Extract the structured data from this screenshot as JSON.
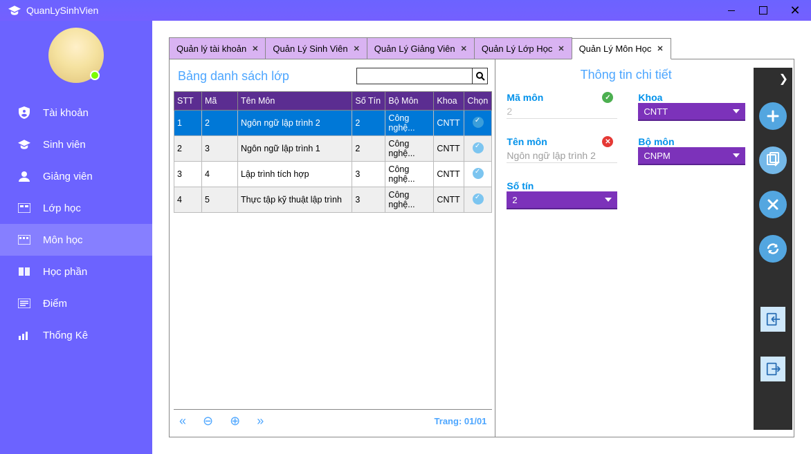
{
  "app": {
    "title": "QuanLySinhVien"
  },
  "sidebar": {
    "items": [
      {
        "label": "Tài khoản",
        "icon": "shield-user-icon"
      },
      {
        "label": "Sinh viên",
        "icon": "grad-cap-small-icon"
      },
      {
        "label": "Giảng viên",
        "icon": "user-icon"
      },
      {
        "label": "Lớp học",
        "icon": "classroom-icon"
      },
      {
        "label": "Môn học",
        "icon": "module-icon"
      },
      {
        "label": "Học phần",
        "icon": "book-icon"
      },
      {
        "label": "Điểm",
        "icon": "score-icon"
      },
      {
        "label": "Thống Kê",
        "icon": "chart-icon"
      }
    ],
    "active_index": 4
  },
  "tabs": [
    {
      "label": "Quản lý tài khoản"
    },
    {
      "label": "Quản Lý Sinh Viên"
    },
    {
      "label": "Quản Lý Giảng Viên"
    },
    {
      "label": "Quản Lý Lớp Học"
    },
    {
      "label": "Quản Lý Môn Học"
    }
  ],
  "active_tab_index": 4,
  "leftPanel": {
    "title": "Bảng danh sách lớp",
    "search_value": "",
    "columns": [
      "STT",
      "Mã",
      "Tên Môn",
      "Số Tín",
      "Bộ Môn",
      "Khoa",
      "Chọn"
    ],
    "rows": [
      {
        "stt": "1",
        "ma": "2",
        "ten": "Ngôn ngữ lập trình 2",
        "sotin": "2",
        "bomon": "Công nghệ...",
        "khoa": "CNTT",
        "selected": true
      },
      {
        "stt": "2",
        "ma": "3",
        "ten": "Ngôn ngữ lập trình 1",
        "sotin": "2",
        "bomon": "Công nghệ...",
        "khoa": "CNTT",
        "selected": false
      },
      {
        "stt": "3",
        "ma": "4",
        "ten": "Lập trình tích hợp",
        "sotin": "3",
        "bomon": "Công nghệ...",
        "khoa": "CNTT",
        "selected": false
      },
      {
        "stt": "4",
        "ma": "5",
        "ten": "Thực tập kỹ thuật lập trình",
        "sotin": "3",
        "bomon": "Công nghệ...",
        "khoa": "CNTT",
        "selected": false
      }
    ],
    "pager_text": "Trang: 01/01"
  },
  "rightPanel": {
    "title": "Thông tin chi tiết",
    "labels": {
      "ma_mon": "Mã môn",
      "ten_mon": "Tên môn",
      "so_tin": "Số tín",
      "khoa": "Khoa",
      "bo_mon": "Bộ môn"
    },
    "values": {
      "ma_mon": "2",
      "ten_mon": "Ngôn ngữ lập trình 2",
      "so_tin": "2",
      "khoa": "CNTT",
      "bo_mon": "CNPM"
    },
    "validation": {
      "ma_mon": "ok",
      "ten_mon": "error"
    }
  }
}
